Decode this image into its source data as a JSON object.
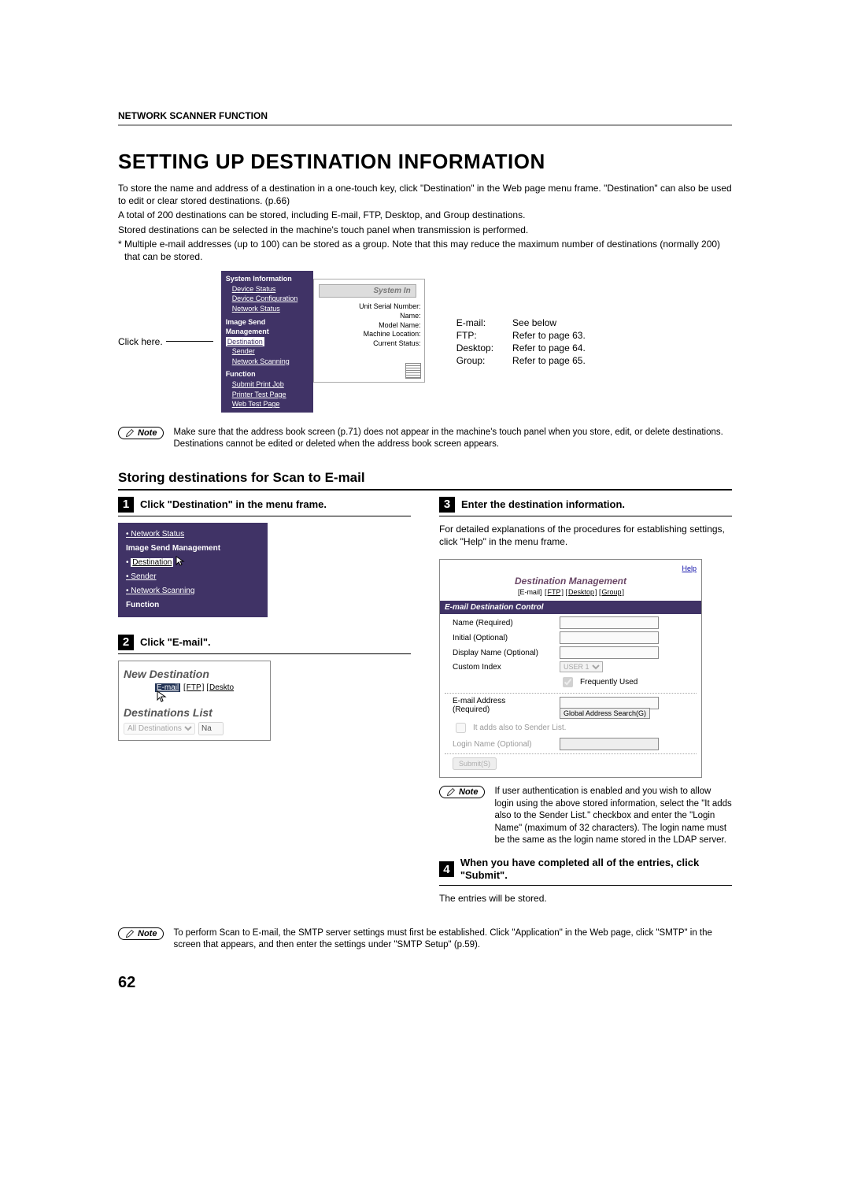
{
  "header": {
    "section": "NETWORK SCANNER FUNCTION"
  },
  "title": "SETTING UP DESTINATION INFORMATION",
  "intro": {
    "p1": "To store the name and address of a destination in a one-touch key, click \"Destination\" in the Web page menu frame. \"Destination\" can also be used to edit or clear stored destinations. (p.66)",
    "p2": "A total of 200 destinations can be stored, including E-mail, FTP, Desktop, and Group destinations.",
    "p3": "Stored destinations can be selected in the machine's touch panel when transmission is performed.",
    "p4": "* Multiple e-mail addresses (up to 100) can be stored as a group. Note that this may reduce the maximum number of destinations (normally 200) that can be stored."
  },
  "fig": {
    "click_here": "Click here.",
    "menu": {
      "h1": "System Information",
      "i1": "Device Status",
      "i2": "Device Configuration",
      "i3": "Network Status",
      "h2": "Image Send Management",
      "i4": "Destination",
      "i5": "Sender",
      "i6": "Network Scanning",
      "h3": "Function",
      "i7": "Submit Print Job",
      "i8": "Printer Test Page",
      "i9": "Web Test Page"
    },
    "sys": {
      "tab": "System In",
      "l1": "Unit Serial Number:",
      "l2": "Name:",
      "l3": "Model Name:",
      "l4": "Machine Location:",
      "l5": "Current Status:"
    },
    "ref": {
      "r1a": "E-mail:",
      "r1b": "See below",
      "r2a": "FTP:",
      "r2b": "Refer to page 63.",
      "r3a": "Desktop:",
      "r3b": "Refer to page 64.",
      "r4a": "Group:",
      "r4b": "Refer to page 65."
    }
  },
  "note1": "Make sure that the address book screen (p.71) does not appear in the machine's touch panel when you store, edit, or delete destinations. Destinations cannot be edited or deleted when the address book screen appears.",
  "subtitle": "Storing destinations for Scan to E-mail",
  "step1": {
    "num": "1",
    "title": "Click \"Destination\" in the menu frame.",
    "img": {
      "i1": "Network Status",
      "h": "Image Send Management",
      "sel": "Destination",
      "i2": "Sender",
      "i3": "Network Scanning",
      "h2": "Function"
    }
  },
  "step2": {
    "num": "2",
    "title": "Click \"E-mail\".",
    "img": {
      "h1": "New Destination",
      "l_email": "E-mail",
      "l_ftp": "FTP",
      "l_desktop": "Deskto",
      "h2": "Destinations List",
      "sel": "All Destinations",
      "na": "Na"
    }
  },
  "step3": {
    "num": "3",
    "title": "Enter the destination information.",
    "body": "For detailed explanations of the procedures for establishing settings, click \"Help\" in the menu frame.",
    "img": {
      "help": "Help",
      "dm": "Destination Management",
      "t_email": "[E-mail]",
      "t_ftp": "FTP",
      "t_desktop": "Desktop",
      "t_group": "Group",
      "bar": "E-mail Destination Control",
      "l_name": "Name (Required)",
      "l_init": "Initial (Optional)",
      "l_disp": "Display Name (Optional)",
      "l_idx": "Custom Index",
      "idx_val": "USER 1",
      "freq": "Frequently Used",
      "l_addr1": "E-mail Address",
      "l_addr2": "(Required)",
      "gas": "Global Address Search(G)",
      "chk": "It adds also to Sender List.",
      "login": "Login Name (Optional)",
      "submit": "Submit(S)"
    },
    "note": "If user authentication is enabled and you wish to allow login using the above stored information, select the \"It adds also to the Sender List.\" checkbox and enter the \"Login Name\" (maximum of 32 characters). The login name must be the same as the login name stored in the LDAP server."
  },
  "step4": {
    "num": "4",
    "title": "When you have completed all of the entries, click \"Submit\".",
    "body": "The entries will be stored."
  },
  "note2": "To perform Scan to E-mail, the SMTP server settings must first be established. Click \"Application\" in the Web page, click \"SMTP\" in the screen that appears, and then enter the settings under \"SMTP Setup\" (p.59).",
  "note_label": "Note",
  "page_num": "62"
}
